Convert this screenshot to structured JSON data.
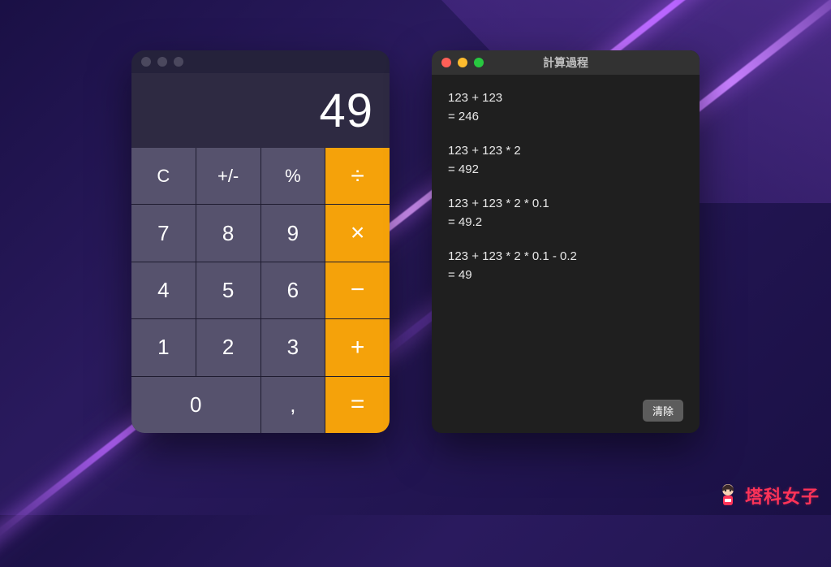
{
  "calculator": {
    "display_value": "49",
    "keys": {
      "clear": "C",
      "sign": "+/-",
      "percent": "%",
      "divide": "÷",
      "multiply": "×",
      "minus": "−",
      "plus": "+",
      "equals": "=",
      "decimal": ",",
      "digits": {
        "0": "0",
        "1": "1",
        "2": "2",
        "3": "3",
        "4": "4",
        "5": "5",
        "6": "6",
        "7": "7",
        "8": "8",
        "9": "9"
      }
    }
  },
  "tape": {
    "window_title": "計算過程",
    "clear_button": "清除",
    "entries": [
      {
        "expression": "123 + 123",
        "result": "= 246"
      },
      {
        "expression": "123 + 123 * 2",
        "result": "= 492"
      },
      {
        "expression": "123 + 123 * 2 * 0.1",
        "result": "= 49.2"
      },
      {
        "expression": "123 + 123 * 2 * 0.1 - 0.2",
        "result": "= 49"
      }
    ]
  },
  "watermark": {
    "text": "塔科女子"
  },
  "colors": {
    "operator_bg": "#f5a20a",
    "key_bg": "#56526d",
    "display_bg": "#2e2a42"
  }
}
